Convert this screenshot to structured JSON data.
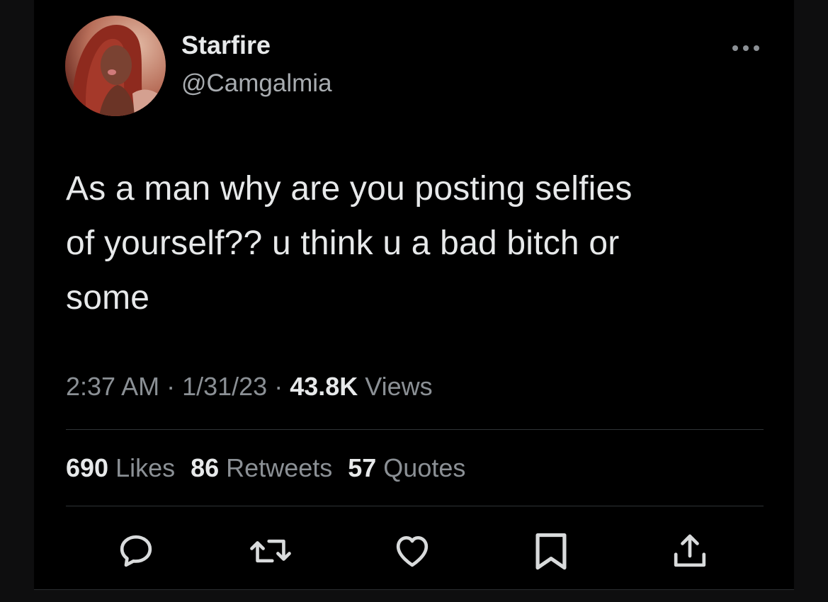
{
  "user": {
    "display_name": "Starfire",
    "handle": "@Camgalmia",
    "avatar": "profile-photo"
  },
  "tweet": {
    "text_lines": [
      "As a man why are you posting selfies",
      "of yourself?? u think u a bad bitch or",
      "some"
    ]
  },
  "meta": {
    "time": "2:37 AM",
    "sep1": " · ",
    "date": "1/31/23",
    "sep2": " · ",
    "views_count": "43.8K",
    "views_label": " Views"
  },
  "stats": {
    "likes_count": "690",
    "likes_label": " Likes",
    "retweets_count": "86",
    "retweets_label": " Retweets",
    "quotes_count": "57",
    "quotes_label": " Quotes"
  },
  "actions": [
    {
      "icon": "reply-icon"
    },
    {
      "icon": "retweet-icon"
    },
    {
      "icon": "like-icon"
    },
    {
      "icon": "bookmark-icon"
    },
    {
      "icon": "share-icon"
    }
  ],
  "colors": {
    "background": "#000000",
    "text_primary": "#e7e9ea",
    "text_secondary": "#8b9095",
    "divider": "#2f3336"
  }
}
